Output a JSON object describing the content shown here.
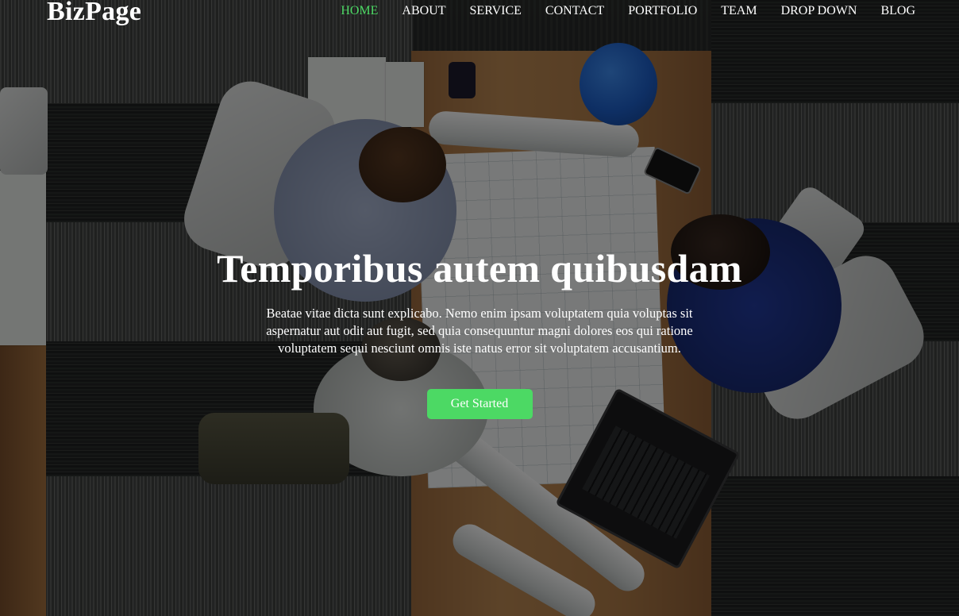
{
  "brand": {
    "logo_text": "BizPage"
  },
  "nav": {
    "items": [
      {
        "label": "HOME",
        "active": true
      },
      {
        "label": "ABOUT"
      },
      {
        "label": "SERVICE"
      },
      {
        "label": "CONTACT"
      },
      {
        "label": "PORTFOLIO"
      },
      {
        "label": "TEAM"
      },
      {
        "label": "DROP DOWN"
      },
      {
        "label": "BLOG"
      }
    ]
  },
  "hero": {
    "title": "Temporibus autem quibusdam",
    "text": "Beatae vitae dicta sunt explicabo. Nemo enim ipsam voluptatem quia voluptas sit aspernatur aut odit aut fugit, sed quia consequuntur magni dolores eos qui ratione voluptatem sequi nesciunt omnis iste natus error sit voluptatem accusantium.",
    "button_label": "Get Started"
  },
  "colors": {
    "accent": "#4cd964",
    "text": "#ffffff",
    "overlay": "rgba(0,0,0,0.5)"
  }
}
